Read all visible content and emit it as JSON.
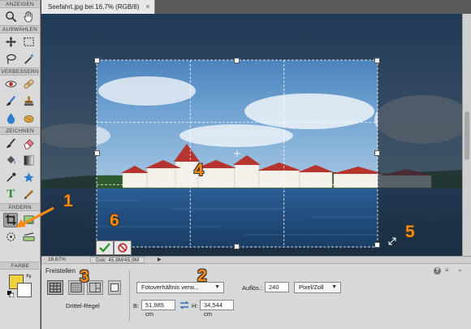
{
  "document": {
    "tab_title": "Seefahrt.jpg bei 16,7% (RGB/8)",
    "close_glyph": "×"
  },
  "tool_panel": {
    "sections": {
      "view": "ANZEIGEN",
      "select": "AUSWÄHLEN",
      "enhance": "VERBESSERN",
      "draw": "ZEICHNEN",
      "modify": "ÄNDERN",
      "color": "FARBE"
    },
    "tools": [
      {
        "name": "zoom-tool",
        "icon": "magnifier-icon"
      },
      {
        "name": "hand-tool",
        "icon": "hand-icon"
      },
      {
        "name": "move-tool",
        "icon": "move-arrows-icon"
      },
      {
        "name": "marquee-tool",
        "icon": "dashed-rectangle-icon"
      },
      {
        "name": "lasso-tool",
        "icon": "lasso-icon"
      },
      {
        "name": "quick-selection-tool",
        "icon": "magic-wand-icon"
      },
      {
        "name": "red-eye-tool",
        "icon": "eye-icon"
      },
      {
        "name": "spot-healing-tool",
        "icon": "bandage-icon"
      },
      {
        "name": "smart-brush-tool",
        "icon": "brush-icon"
      },
      {
        "name": "clone-stamp-tool",
        "icon": "stamp-icon"
      },
      {
        "name": "blur-tool",
        "icon": "droplet-icon"
      },
      {
        "name": "sponge-tool",
        "icon": "sponge-icon"
      },
      {
        "name": "brush-tool",
        "icon": "brush-icon"
      },
      {
        "name": "eraser-tool",
        "icon": "eraser-icon"
      },
      {
        "name": "paint-bucket-tool",
        "icon": "bucket-icon"
      },
      {
        "name": "gradient-tool",
        "icon": "gradient-icon"
      },
      {
        "name": "eyedropper-tool",
        "icon": "eyedropper-icon"
      },
      {
        "name": "custom-shape-tool",
        "icon": "star-shape-icon"
      },
      {
        "name": "type-tool",
        "icon": "letter-t-icon",
        "glyph": "T"
      },
      {
        "name": "pencil-tool",
        "icon": "pencil-icon"
      },
      {
        "name": "crop-tool",
        "icon": "crop-icon",
        "active": true
      },
      {
        "name": "recompose-tool",
        "icon": "recompose-icon"
      },
      {
        "name": "content-aware-move-tool",
        "icon": "move-content-icon"
      },
      {
        "name": "straighten-tool",
        "icon": "straighten-icon"
      }
    ],
    "foreground_color": "#f2d23c",
    "background_color": "#ffffff"
  },
  "canvas": {
    "callouts": [
      "1",
      "2",
      "3",
      "4",
      "5",
      "6"
    ],
    "commit_icon": "checkmark-icon",
    "cancel_icon": "cancel-circle-icon",
    "overlay_color": "#1d2a36",
    "accent_color": "#ff8a10"
  },
  "status_bar": {
    "zoom": "16,67%",
    "doc_info": "Dok: 45,9M/45,9M",
    "arrow": "▶"
  },
  "options_bar": {
    "title": "Freistellen",
    "overlay_label": "Drittel-Regel",
    "aspect_dropdown": "Fotoverhältnis verw...",
    "resolution_label": "Auflös.:",
    "resolution_value": "240",
    "unit_dropdown": "Pixel/Zoll",
    "width_label": "B:",
    "width_value": "51,985 cm",
    "height_label": "H:",
    "height_value": "34,544 cm",
    "help_glyph": "?",
    "menu_glyph": "≡",
    "collapse_glyph": "⌄"
  }
}
